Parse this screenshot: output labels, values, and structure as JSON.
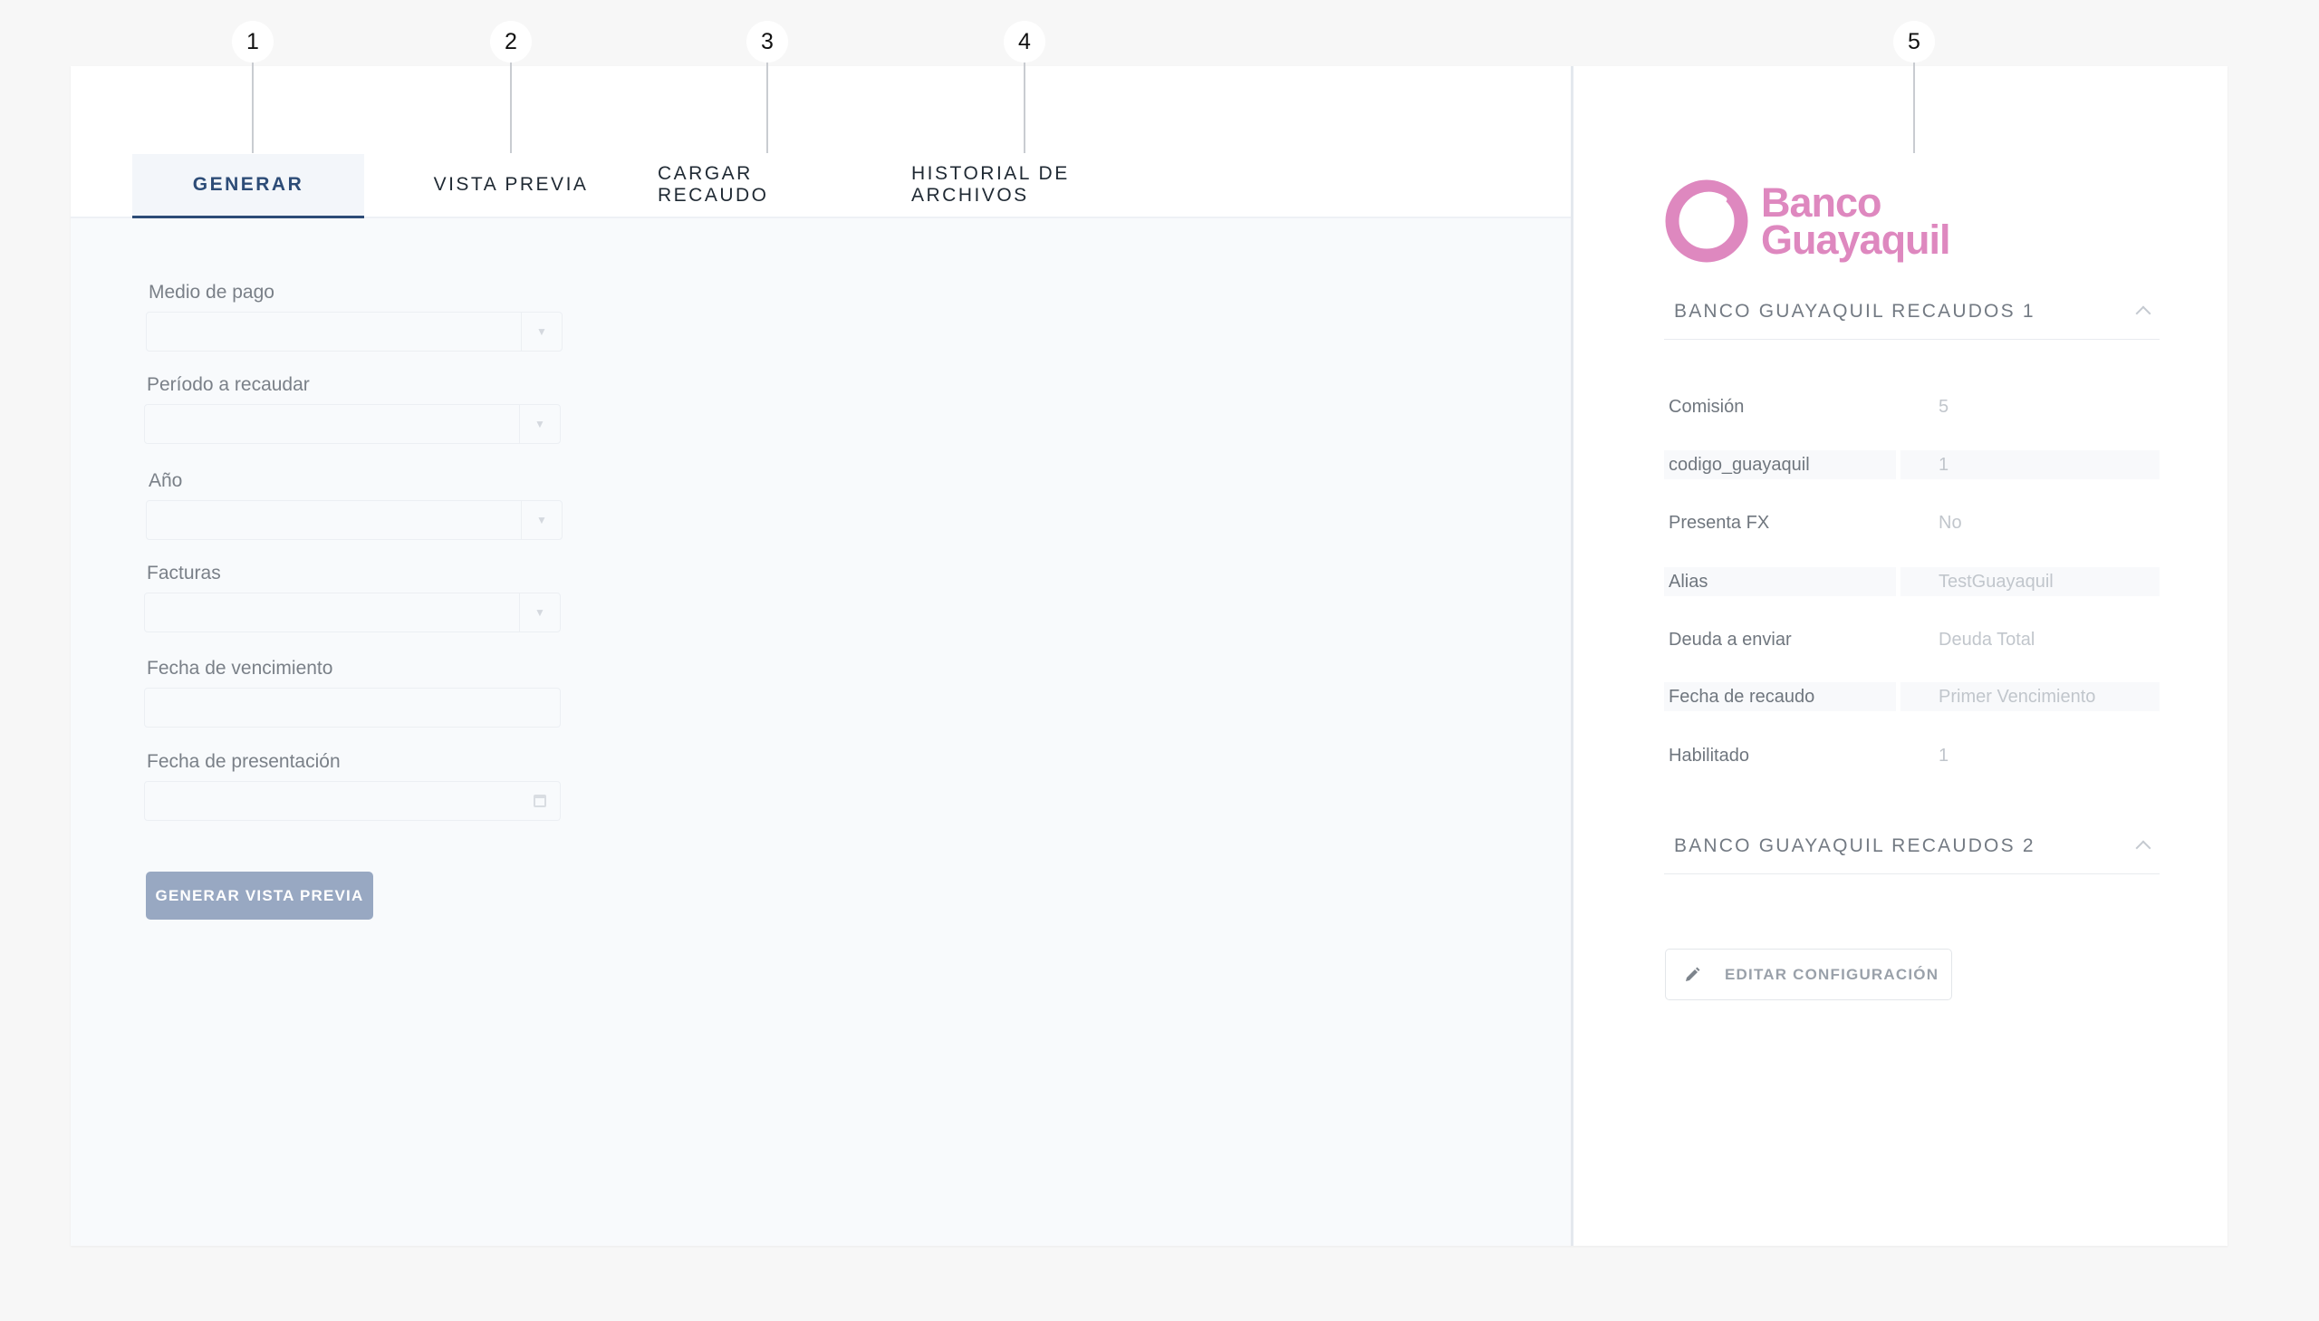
{
  "callouts": [
    "1",
    "2",
    "3",
    "4",
    "5"
  ],
  "tabs": [
    {
      "label": "GENERAR",
      "active": true
    },
    {
      "label": "VISTA PREVIA",
      "active": false
    },
    {
      "label": "CARGAR RECAUDO",
      "active": false
    },
    {
      "label": "HISTORIAL DE ARCHIVOS",
      "active": false
    }
  ],
  "form": {
    "medio_pago_label": "Medio de pago",
    "periodo_label": "Período a recaudar",
    "anio_label": "Año",
    "facturas_label": "Facturas",
    "fecha_vencimiento_label": "Fecha de vencimiento",
    "fecha_presentacion_label": "Fecha de presentación",
    "generate_button": "GENERAR VISTA PREVIA"
  },
  "bank": {
    "logo_line1": "Banco",
    "logo_line2": "Guayaquil",
    "brand_color": "#de88bf",
    "accordion1": {
      "title": "BANCO GUAYAQUIL RECAUDOS 1",
      "rows": [
        {
          "key": "Comisión",
          "value": "5"
        },
        {
          "key": "codigo_guayaquil",
          "value": "1"
        },
        {
          "key": "Presenta FX",
          "value": "No"
        },
        {
          "key": "Alias",
          "value": "TestGuayaquil"
        },
        {
          "key": "Deuda a enviar",
          "value": "Deuda Total"
        },
        {
          "key": "Fecha de recaudo",
          "value": "Primer Vencimiento"
        },
        {
          "key": "Habilitado",
          "value": "1"
        }
      ]
    },
    "accordion2": {
      "title": "BANCO GUAYAQUIL RECAUDOS 2"
    },
    "edit_button": "EDITAR CONFIGURACIÓN"
  },
  "colors": {
    "tab_active": "#2d4c77",
    "primary_button": "#98a8c2"
  },
  "icons": [
    "chevron-down-icon",
    "calendar-icon",
    "chevron-up-icon",
    "pencil-icon",
    "bank-logo-icon"
  ]
}
